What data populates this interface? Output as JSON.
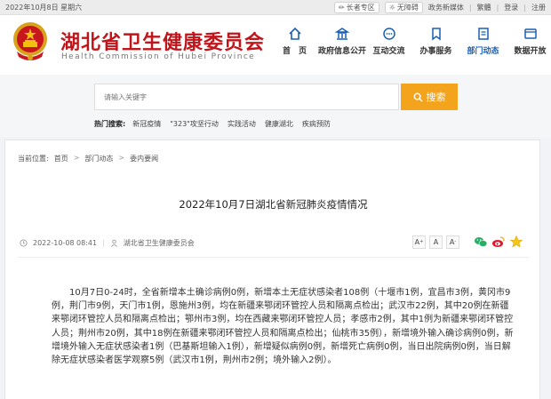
{
  "topbar": {
    "date": "2022年10月8日 星期六",
    "elder_zone": "长者专区",
    "accessible": "无障碍",
    "gov_media": "政务新媒体",
    "traditional": "繁體",
    "login": "登录",
    "register": "注册",
    "sep": "|"
  },
  "header": {
    "title": "湖北省卫生健康委员会",
    "subtitle": "Health Commission of Hubei Province",
    "nav": [
      {
        "label": "首　页",
        "icon": "home-icon"
      },
      {
        "label": "政府信息公开",
        "icon": "bank-icon"
      },
      {
        "label": "互动交流",
        "icon": "chat-icon"
      },
      {
        "label": "办事服务",
        "icon": "bookmark-icon"
      },
      {
        "label": "部门动态",
        "icon": "document-icon"
      },
      {
        "label": "数据开放",
        "icon": "data-icon"
      }
    ],
    "active_color": "#1a5fb4",
    "brand_color": "#c0151a"
  },
  "search": {
    "placeholder": "请输入关键字",
    "button": "搜索",
    "button_color": "#f4a41c",
    "hot_label": "热门搜索:",
    "hot": [
      "新冠疫情",
      "\"323\"攻坚行动",
      "实践活动",
      "健康湖北",
      "疾病预防"
    ]
  },
  "breadcrumb": {
    "current": "当前位置:",
    "items": [
      "首页",
      "部门动态",
      "委内要闻"
    ],
    "sep": ">"
  },
  "article": {
    "title": "2022年10月7日湖北省新冠肺炎疫情情况",
    "datetime": "2022-10-08 08:41",
    "source": "湖北省卫生健康委员会",
    "font_sizes": [
      "A",
      "A",
      "A"
    ],
    "body": "10月7日0-24时，全省新增本土确诊病例0例，新增本土无症状感染者108例（十堰市1例，宜昌市3例，黄冈市9例，荆门市9例，天门市1例，恩施州3例，均在新疆来鄂闭环管控人员和隔离点检出；武汉市22例，其中20例在新疆来鄂闭环管控人员和隔离点检出；鄂州市3例，均在西藏来鄂闭环管控人员；孝感市2例，其中1例为新疆来鄂闭环管控人员；荆州市20例，其中18例在新疆来鄂闭环管控人员和隔离点检出；仙桃市35例），新增境外输入确诊病例0例，新增境外输入无症状感染者1例（巴基斯坦输入1例），新增疑似病例0例，新增死亡病例0例，当日出院病例0例，当日解除无症状感染者医学观察5例（武汉市1例，荆州市2例；境外输入2例）。"
  }
}
